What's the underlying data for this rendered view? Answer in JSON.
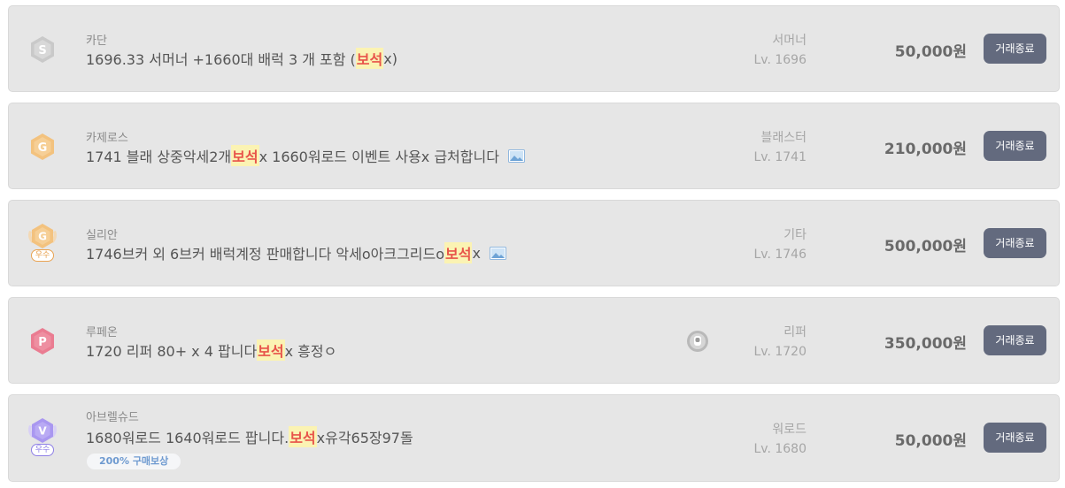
{
  "listings": [
    {
      "server": "카단",
      "title_pre": "1696.33 서머너 +1660대 배럭 3 개 포함 (",
      "highlight": "보석",
      "title_post": "x)",
      "class": "서머너",
      "level": "Lv. 1696",
      "price": "50,000원",
      "button": "거래종료",
      "badge": {
        "letter": "S",
        "color": "#c9c9c9",
        "icon": "hexagon-s-icon"
      },
      "has_image": false
    },
    {
      "server": "카제로스",
      "title_pre": "1741 블래 상중악세2개 ",
      "highlight": "보석",
      "title_post": "x 1660워로드 이벤트 사용x 급처합니다",
      "class": "블래스터",
      "level": "Lv. 1741",
      "price": "210,000원",
      "button": "거래종료",
      "badge": {
        "letter": "G",
        "color": "#f3c27e",
        "icon": "hexagon-g-icon"
      },
      "has_image": true
    },
    {
      "server": "실리안",
      "title_pre": "1746브커 외 6브커 배럭계정 판매합니다 악세o아크그리드o",
      "highlight": "보석",
      "title_post": "x",
      "class": "기타",
      "level": "Lv. 1746",
      "price": "500,000원",
      "button": "거래종료",
      "badge": {
        "letter": "G",
        "color": "#f3c27e",
        "icon": "winged-hexagon-g-icon",
        "tier": "우수",
        "tier_color": "#e9a352"
      },
      "has_image": true
    },
    {
      "server": "루페온",
      "title_pre": "1720 리퍼 80+ x 4 팝니다 ",
      "highlight": "보석",
      "title_post": "x 흥정ㅇ",
      "class": "리퍼",
      "level": "Lv. 1720",
      "price": "350,000원",
      "button": "거래종료",
      "badge": {
        "letter": "P",
        "color": "#ea7c91",
        "icon": "hexagon-p-icon"
      },
      "has_image": false,
      "avatar": "seller-avatar-icon"
    },
    {
      "server": "아브렐슈드",
      "title_pre": "1680워로드 1640워로드 팝니다. ",
      "highlight": "보석",
      "title_post": "x유각65장97돌",
      "class": "워로드",
      "level": "Lv. 1680",
      "price": "50,000원",
      "button": "거래종료",
      "badge": {
        "letter": "V",
        "color": "#b3a5f2",
        "icon": "winged-hexagon-v-icon",
        "tier": "우수",
        "tier_color": "#8e7fe6"
      },
      "has_image": false,
      "reward": "200% 구매보상"
    }
  ]
}
